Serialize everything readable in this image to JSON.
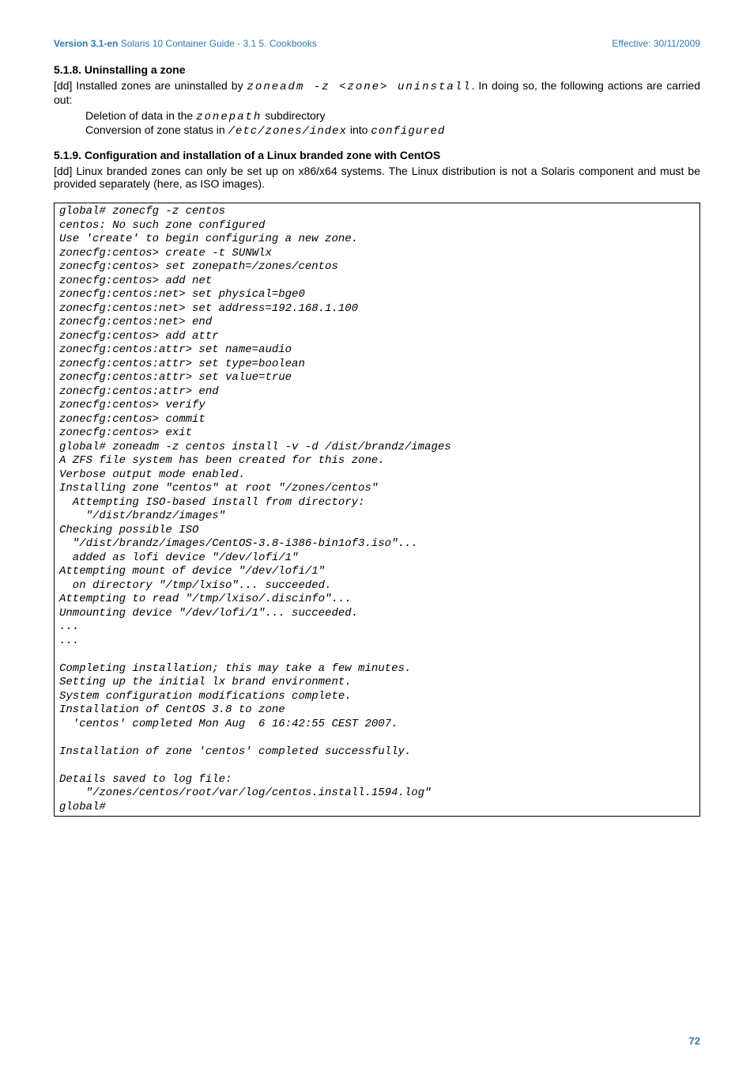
{
  "header": {
    "version": "Version 3.1-en",
    "title_suffix": "  Solaris 10 Container Guide - 3.1  5. Cookbooks",
    "effective": "Effective: 30/11/2009"
  },
  "section_518": {
    "heading": "5.1.8. Uninstalling a zone",
    "intro_prefix": "[dd] Installed zones are uninstalled by ",
    "intro_code": "zoneadm -z <zone> uninstall",
    "intro_suffix": ". In doing so, the following actions are carried out:",
    "bullet1_prefix": "Deletion of data in the ",
    "bullet1_code": "zonepath",
    "bullet1_suffix": " subdirectory",
    "bullet2_prefix": "Conversion of zone status in ",
    "bullet2_code1": "/etc/zones/index",
    "bullet2_mid": " into ",
    "bullet2_code2": "configured"
  },
  "section_519": {
    "heading": "5.1.9. Configuration and installation of a Linux branded zone with CentOS",
    "intro": "[dd] Linux branded zones can only be set up on x86/x64 systems. The Linux distribution is not a Solaris component and must be provided separately (here, as ISO images)."
  },
  "code_block": "global# zonecfg -z centos \ncentos: No such zone configured \nUse 'create' to begin configuring a new zone. \nzonecfg:centos> create -t SUNWlx \nzonecfg:centos> set zonepath=/zones/centos \nzonecfg:centos> add net \nzonecfg:centos:net> set physical=bge0 \nzonecfg:centos:net> set address=192.168.1.100 \nzonecfg:centos:net> end \nzonecfg:centos> add attr \nzonecfg:centos:attr> set name=audio \nzonecfg:centos:attr> set type=boolean \nzonecfg:centos:attr> set value=true \nzonecfg:centos:attr> end \nzonecfg:centos> verify \nzonecfg:centos> commit \nzonecfg:centos> exit \nglobal# zoneadm -z centos install -v -d /dist/brandz/images \nA ZFS file system has been created for this zone. \nVerbose output mode enabled. \nInstalling zone \"centos\" at root \"/zones/centos\" \n  Attempting ISO-based install from directory: \n    \"/dist/brandz/images\" \nChecking possible ISO \n  \"/dist/brandz/images/CentOS-3.8-i386-bin1of3.iso\"... \n  added as lofi device \"/dev/lofi/1\" \nAttempting mount of device \"/dev/lofi/1\" \n  on directory \"/tmp/lxiso\"... succeeded. \nAttempting to read \"/tmp/lxiso/.discinfo\"... \nUnmounting device \"/dev/lofi/1\"... succeeded. \n... \n... \n\nCompleting installation; this may take a few minutes. \nSetting up the initial lx brand environment. \nSystem configuration modifications complete. \nInstallation of CentOS 3.8 to zone \n  'centos' completed Mon Aug  6 16:42:55 CEST 2007. \n\nInstallation of zone 'centos' completed successfully. \n\nDetails saved to log file: \n    \"/zones/centos/root/var/log/centos.install.1594.log\" \nglobal#",
  "page_number": "72"
}
